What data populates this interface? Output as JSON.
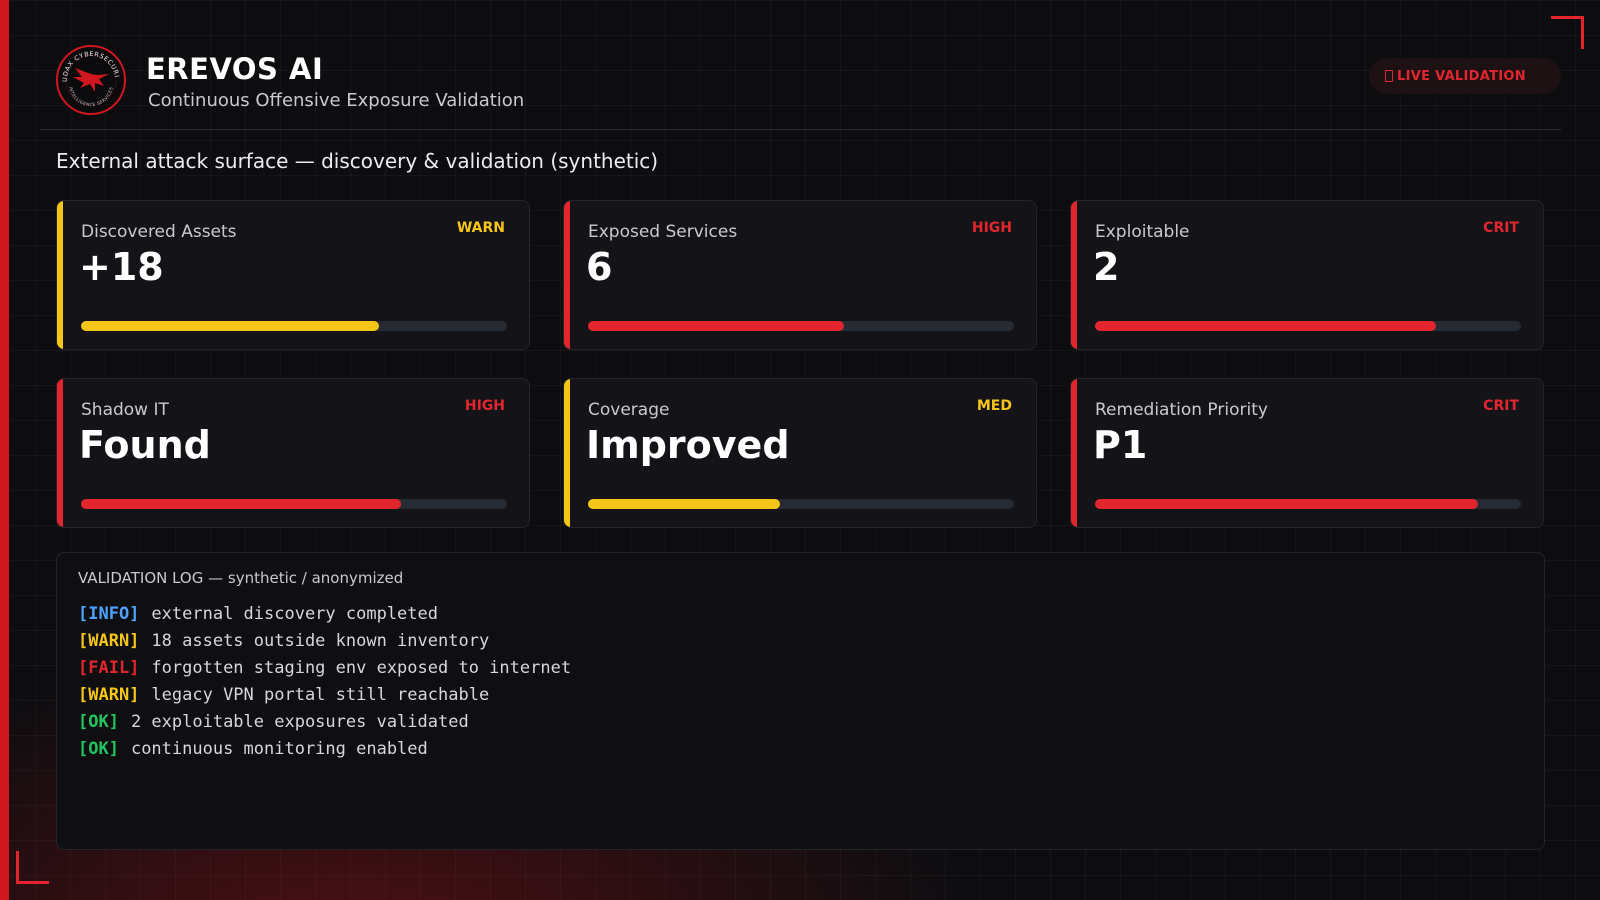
{
  "header": {
    "logo_text": "AUDAX CYBERSECURITY",
    "logo_subtext": "INTELLIGENCE SERVICES",
    "title": "EREVOS AI",
    "subtitle": "Continuous Offensive Exposure Validation",
    "badge": "LIVE VALIDATION",
    "badge_icon": "lock-icon"
  },
  "section_title": "External attack surface — discovery & validation (synthetic)",
  "colors": {
    "accent_red": "#e3262d",
    "warn_yellow": "#f5c518",
    "info_blue": "#4da3ff",
    "ok_green": "#22c55e"
  },
  "cards": [
    {
      "label": "Discovered Assets",
      "severity": "WARN",
      "value": "+18",
      "progress": 0.7,
      "color": "#f5c518"
    },
    {
      "label": "Exposed Services",
      "severity": "HIGH",
      "value": "6",
      "progress": 0.6,
      "color": "#e3262d"
    },
    {
      "label": "Exploitable",
      "severity": "CRIT",
      "value": "2",
      "progress": 0.8,
      "color": "#e3262d"
    },
    {
      "label": "Shadow IT",
      "severity": "HIGH",
      "value": "Found",
      "progress": 0.75,
      "color": "#e3262d"
    },
    {
      "label": "Coverage",
      "severity": "MED",
      "value": "Improved",
      "progress": 0.45,
      "color": "#f5c518"
    },
    {
      "label": "Remediation Priority",
      "severity": "CRIT",
      "value": "P1",
      "progress": 0.9,
      "color": "#e3262d"
    }
  ],
  "log": {
    "title": "VALIDATION LOG — synthetic / anonymized",
    "lines": [
      {
        "tag": "[INFO]",
        "color": "#4da3ff",
        "text": "external discovery completed"
      },
      {
        "tag": "[WARN]",
        "color": "#f5c518",
        "text": "18 assets outside known inventory"
      },
      {
        "tag": "[FAIL]",
        "color": "#e3262d",
        "text": "forgotten staging env exposed to internet"
      },
      {
        "tag": "[WARN]",
        "color": "#f5c518",
        "text": "legacy VPN portal still reachable"
      },
      {
        "tag": "[OK]",
        "color": "#22c55e",
        "text": "2 exploitable exposures validated"
      },
      {
        "tag": "[OK]",
        "color": "#22c55e",
        "text": "continuous monitoring enabled"
      }
    ]
  }
}
